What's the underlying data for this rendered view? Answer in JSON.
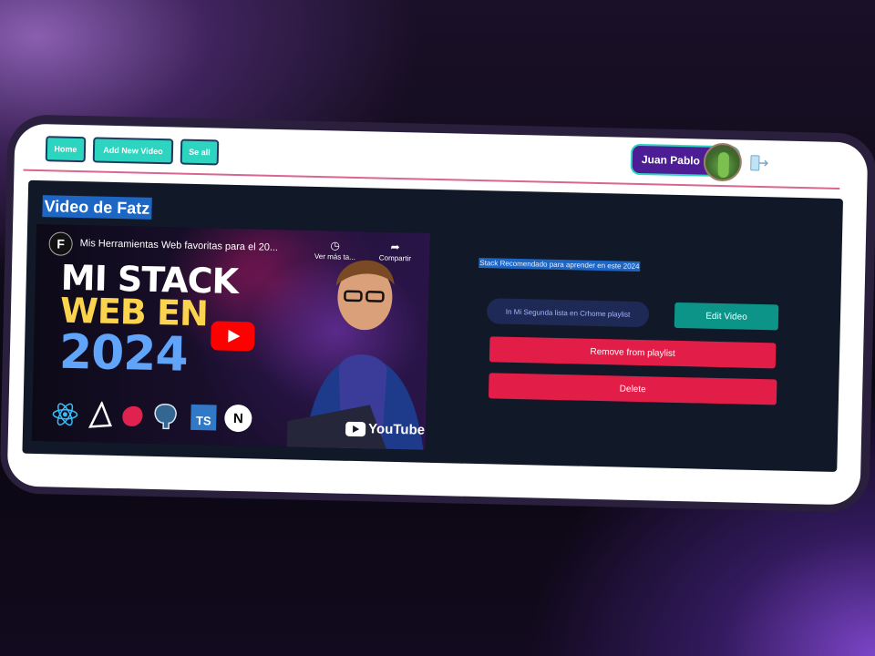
{
  "nav": {
    "home_label": "Home",
    "add_video_label": "Add New Video",
    "see_all_label": "Se all"
  },
  "user": {
    "name": "Juan Pablo"
  },
  "video_card": {
    "title": "Video de Fatz",
    "description": "Stack Recomendado para aprender en este 2024",
    "playlist_chip": "In Mi Segunda lista en Crhome playlist",
    "edit_label": "Edit Video",
    "remove_label": "Remove from playlist",
    "delete_label": "Delete"
  },
  "embed": {
    "channel_initial": "F",
    "video_title": "Mis Herramientas Web favoritas para el 20...",
    "watch_later_label": "Ver más ta...",
    "share_label": "Compartir",
    "thumb_line1": "MI STACK",
    "thumb_line2": "WEB EN",
    "thumb_line3": "2024",
    "ts_badge": "TS",
    "next_badge": "N",
    "youtube_label": "YouTube"
  },
  "colors": {
    "accent_teal": "#2dd4bf",
    "danger": "#e11d48",
    "panel_bg": "#111827",
    "user_pill": "#4c1d95",
    "highlight": "#1d66c4"
  },
  "icons": {
    "logout": "logout-icon",
    "play": "play-icon",
    "clock": "clock-icon",
    "share": "share-icon"
  }
}
